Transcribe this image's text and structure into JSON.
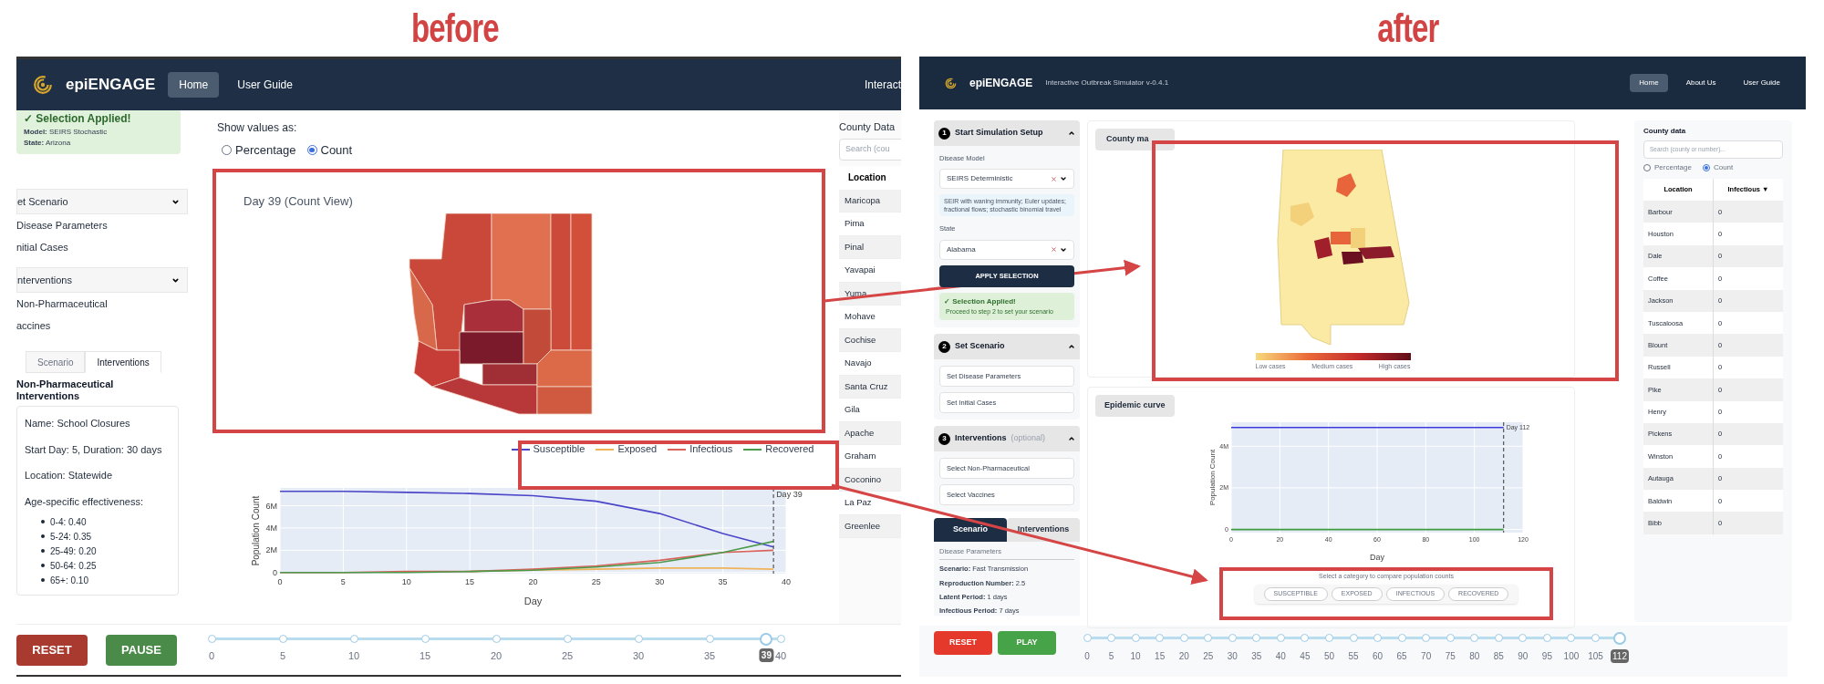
{
  "before": {
    "caption": "before",
    "navbar": {
      "brand": "epiENGAGE",
      "links": [
        {
          "label": "Home",
          "selected": true
        },
        {
          "label": "User Guide",
          "selected": false
        }
      ],
      "right_text": "Interact"
    },
    "sidebar": {
      "notice": {
        "title": "✓ Selection Applied!",
        "lines": [
          "**Model:** SEIRS Stochastic",
          "**State:** Arizona"
        ]
      },
      "sections": [
        {
          "title": "et Scenario",
          "items": [
            "Disease Parameters",
            "nitial Cases"
          ]
        },
        {
          "title": "nterventions",
          "items": [
            "Non-Pharmaceutical",
            "accines"
          ]
        }
      ],
      "tabs": [
        {
          "label": "Scenario",
          "selected": false
        },
        {
          "label": "Interventions",
          "selected": true
        }
      ],
      "heading": "Non-Pharmaceutical Interventions",
      "details": [
        "Name: School Closures",
        "Start Day: 5, Duration: 30 days",
        "Location: Statewide",
        "Age-specific effectiveness:"
      ],
      "bullets": [
        "0-4: 0.40",
        "5-24: 0.35",
        "25-49: 0.20",
        "50-64: 0.25",
        "65+: 0.10"
      ]
    },
    "main": {
      "values_label": "Show values as:",
      "value_modes": [
        {
          "label": "Percentage",
          "selected": false
        },
        {
          "label": "Count",
          "selected": true
        }
      ],
      "map_title": "Day 39 (Count View)",
      "chart_data": {
        "type": "line",
        "xlabel": "Day",
        "ylabel": "Population Count",
        "x": [
          0,
          5,
          10,
          15,
          20,
          25,
          30,
          35,
          39
        ],
        "series": [
          {
            "name": "Susceptible",
            "color": "#4b45c8",
            "values": [
              7300000,
              7300000,
              7200000,
              7100000,
              6900000,
              6400000,
              5300000,
              3500000,
              2300000
            ]
          },
          {
            "name": "Exposed",
            "color": "#f0b35a",
            "values": [
              null,
              null,
              null,
              100000,
              200000,
              300000,
              400000,
              400000,
              300000
            ]
          },
          {
            "name": "Infectious",
            "color": "#d9625a",
            "values": [
              0,
              0,
              100000,
              100000,
              300000,
              600000,
              1100000,
              1800000,
              2000000
            ]
          },
          {
            "name": "Recovered",
            "color": "#4c9a4c",
            "values": [
              0,
              0,
              0,
              100000,
              200000,
              500000,
              900000,
              1800000,
              2800000
            ]
          }
        ],
        "xlim": [
          0,
          40
        ],
        "ylim": [
          -100000,
          7600000
        ],
        "xticks": [
          0,
          5,
          10,
          15,
          20,
          25,
          30,
          35,
          40
        ],
        "yticks": [
          {
            "value": 0,
            "label": "0"
          },
          {
            "value": 2000000,
            "label": "2M"
          },
          {
            "value": 4000000,
            "label": "4M"
          },
          {
            "value": 6000000,
            "label": "6M"
          }
        ],
        "grid": true,
        "legend": true,
        "ref_lines": [
          {
            "axis": "x",
            "value": 39,
            "label": "Day 39"
          }
        ]
      }
    },
    "county_table": {
      "title": "County Data",
      "search_placeholder": "Search (cou",
      "columns": [
        "Location"
      ],
      "rows": [
        "Maricopa",
        "Pima",
        "Pinal",
        "Yavapai",
        "Yuma",
        "Mohave",
        "Cochise",
        "Navajo",
        "Santa Cruz",
        "Gila",
        "Apache",
        "Graham",
        "Coconino",
        "La Paz",
        "Greenlee"
      ]
    },
    "controls": {
      "buttons": [
        {
          "label": "RESET",
          "kind": "reset"
        },
        {
          "label": "PAUSE",
          "kind": "play"
        }
      ],
      "slider": {
        "ticks": [
          "0",
          "5",
          "10",
          "15",
          "20",
          "25",
          "30",
          "35",
          "40"
        ],
        "level": 0.975,
        "value": "39"
      }
    }
  },
  "after": {
    "caption": "after",
    "navbar": {
      "brand": "epiENGAGE",
      "subtitle": "Interactive Outbreak Simulator v-0.4.1",
      "links": [
        {
          "label": "Home",
          "selected": true
        },
        {
          "label": "About Us",
          "selected": false
        },
        {
          "label": "User Guide",
          "selected": false
        }
      ]
    },
    "sidebar": {
      "steps": [
        {
          "number": "1",
          "title": "Start Simulation Setup",
          "expanded": true,
          "kind": "setup",
          "fields": [
            {
              "label": "Disease Model",
              "value": "SEIRS Deterministic"
            },
            {
              "label": "State",
              "value": "Alabama"
            }
          ],
          "info": "SEIR with waning immunity; Euler updates; fractional flows; stochastic binomial travel",
          "button": "APPLY SELECTION",
          "notice": {
            "title": "✓ Selection Applied!",
            "text": "Proceed to step 2 to set your scenario"
          }
        },
        {
          "number": "2",
          "title": "Set Scenario",
          "expanded": true,
          "kind": "options",
          "options": [
            "Set Disease Parameters",
            "Set Initial Cases"
          ]
        },
        {
          "number": "3",
          "title": "Interventions",
          "suffix": "(optional)",
          "expanded": true,
          "kind": "options",
          "options": [
            "Select Non-Pharmaceutical",
            "Select Vaccines"
          ]
        }
      ],
      "tabs": [
        {
          "label": "Scenario",
          "selected": true
        },
        {
          "label": "Interventions",
          "selected": false
        }
      ],
      "section": "Disease Parameters",
      "lines": [
        "**Scenario:** Fast Transmission",
        "**Reproduction Number:** 2.5",
        "**Latent Period:** 1 days",
        "**Infectious Period:** 7 days"
      ]
    },
    "main": {
      "map_tab": "County ma",
      "legend": [
        "Low cases",
        "Medium cases",
        "High cases"
      ],
      "curve_tab": "Epidemic curve",
      "chart_data": {
        "type": "line",
        "xlabel": "Day",
        "ylabel": "Population Count",
        "x": [
          0,
          112
        ],
        "series": [
          {
            "color": "#3b3bdc",
            "values": [
              4900000,
              4900000
            ]
          },
          {
            "color": "#3e9a3e",
            "values": [
              0,
              0
            ]
          }
        ],
        "xlim": [
          0,
          120
        ],
        "ylim": [
          -150000,
          5150000
        ],
        "xticks": [
          0,
          20,
          40,
          60,
          80,
          100,
          120
        ],
        "yticks": [
          {
            "value": 0,
            "label": "0"
          },
          {
            "value": 2000000,
            "label": "2M"
          },
          {
            "value": 4000000,
            "label": "4M"
          }
        ],
        "grid": true,
        "ref_lines": [
          {
            "axis": "x",
            "value": 112,
            "label": "Day 112"
          }
        ]
      },
      "category_prompt": "Select a category to compare population counts",
      "categories": [
        "SUSCEPTIBLE",
        "EXPOSED",
        "INFECTIOUS",
        "RECOVERED"
      ]
    },
    "county_table": {
      "title": "County data",
      "search_placeholder": "Search (county or number)...",
      "value_modes": [
        {
          "label": "Percentage",
          "selected": false
        },
        {
          "label": "Count",
          "selected": true
        }
      ],
      "columns": [
        "Location",
        "Infectious ▼"
      ],
      "rows": [
        [
          "Barbour",
          "0"
        ],
        [
          "Houston",
          "0"
        ],
        [
          "Dale",
          "0"
        ],
        [
          "Coffee",
          "0"
        ],
        [
          "Jackson",
          "0"
        ],
        [
          "Tuscaloosa",
          "0"
        ],
        [
          "Blount",
          "0"
        ],
        [
          "Russell",
          "0"
        ],
        [
          "Pike",
          "0"
        ],
        [
          "Henry",
          "0"
        ],
        [
          "Pickens",
          "0"
        ],
        [
          "Winston",
          "0"
        ],
        [
          "Autauga",
          "0"
        ],
        [
          "Baldwin",
          "0"
        ],
        [
          "Bibb",
          "0"
        ]
      ]
    },
    "controls": {
      "buttons": [
        {
          "label": "RESET",
          "kind": "reset"
        },
        {
          "label": "PLAY",
          "kind": "play"
        }
      ],
      "slider": {
        "ticks": [
          "0",
          "5",
          "10",
          "15",
          "20",
          "25",
          "30",
          "35",
          "40",
          "45",
          "50",
          "55",
          "60",
          "65",
          "70",
          "75",
          "80",
          "85",
          "90",
          "95",
          "100",
          "105"
        ],
        "level": 1,
        "value": "112"
      }
    }
  }
}
